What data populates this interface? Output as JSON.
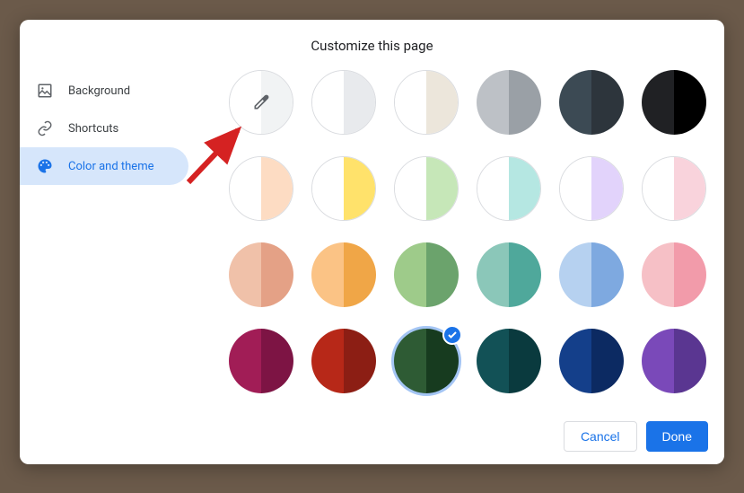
{
  "title": "Customize this page",
  "sidebar": {
    "items": [
      {
        "id": "background",
        "label": "Background",
        "icon": "image-frame-icon",
        "active": false
      },
      {
        "id": "shortcuts",
        "label": "Shortcuts",
        "icon": "link-icon",
        "active": false
      },
      {
        "id": "color-theme",
        "label": "Color and theme",
        "icon": "palette-icon",
        "active": true
      }
    ]
  },
  "palette": {
    "rows": [
      [
        {
          "name": "color-picker",
          "type": "picker",
          "left": "#ffffff",
          "right": "#f1f3f4",
          "bordered": true
        },
        {
          "name": "light-grey",
          "left": "#ffffff",
          "right": "#e8eaed",
          "bordered": true
        },
        {
          "name": "warm-grey",
          "left": "#ffffff",
          "right": "#ece6db",
          "bordered": true
        },
        {
          "name": "grey",
          "left": "#bdc1c6",
          "right": "#9aa0a6"
        },
        {
          "name": "dark-slate",
          "left": "#3c4a54",
          "right": "#2d353c"
        },
        {
          "name": "black",
          "left": "#202124",
          "right": "#000000"
        }
      ],
      [
        {
          "name": "pastel-peach",
          "left": "#ffffff",
          "right": "#fddcc3",
          "bordered": true
        },
        {
          "name": "pastel-yellow",
          "left": "#ffffff",
          "right": "#ffe26b",
          "bordered": true
        },
        {
          "name": "pastel-green",
          "left": "#ffffff",
          "right": "#c6e7b8",
          "bordered": true
        },
        {
          "name": "pastel-teal",
          "left": "#ffffff",
          "right": "#b5e7e2",
          "bordered": true
        },
        {
          "name": "pastel-lavender",
          "left": "#ffffff",
          "right": "#e2d3fb",
          "bordered": true
        },
        {
          "name": "pastel-pink",
          "left": "#ffffff",
          "right": "#f9d3dc",
          "bordered": true
        }
      ],
      [
        {
          "name": "peach",
          "left": "#f0c1a9",
          "right": "#e4a186"
        },
        {
          "name": "orange",
          "left": "#fbc385",
          "right": "#f0a647"
        },
        {
          "name": "green",
          "left": "#9ecb8a",
          "right": "#6ba36c"
        },
        {
          "name": "teal",
          "left": "#8bc7b9",
          "right": "#4fa89b"
        },
        {
          "name": "blue",
          "left": "#b6d1f0",
          "right": "#7ea9e0"
        },
        {
          "name": "pink",
          "left": "#f6c0c6",
          "right": "#f29baa"
        }
      ],
      [
        {
          "name": "magenta",
          "left": "#a11d56",
          "right": "#7d1444"
        },
        {
          "name": "red",
          "left": "#b72818",
          "right": "#8c1e14"
        },
        {
          "name": "forest-green",
          "left": "#2e5b34",
          "right": "#173b1f",
          "selected": true
        },
        {
          "name": "deep-teal",
          "left": "#125156",
          "right": "#0a3a3e"
        },
        {
          "name": "navy",
          "left": "#143f8a",
          "right": "#0c2a62"
        },
        {
          "name": "purple",
          "left": "#7a49b9",
          "right": "#5a3691"
        }
      ]
    ]
  },
  "footer": {
    "cancel_label": "Cancel",
    "done_label": "Done"
  },
  "annotation": {
    "arrow_color": "#d52222"
  }
}
